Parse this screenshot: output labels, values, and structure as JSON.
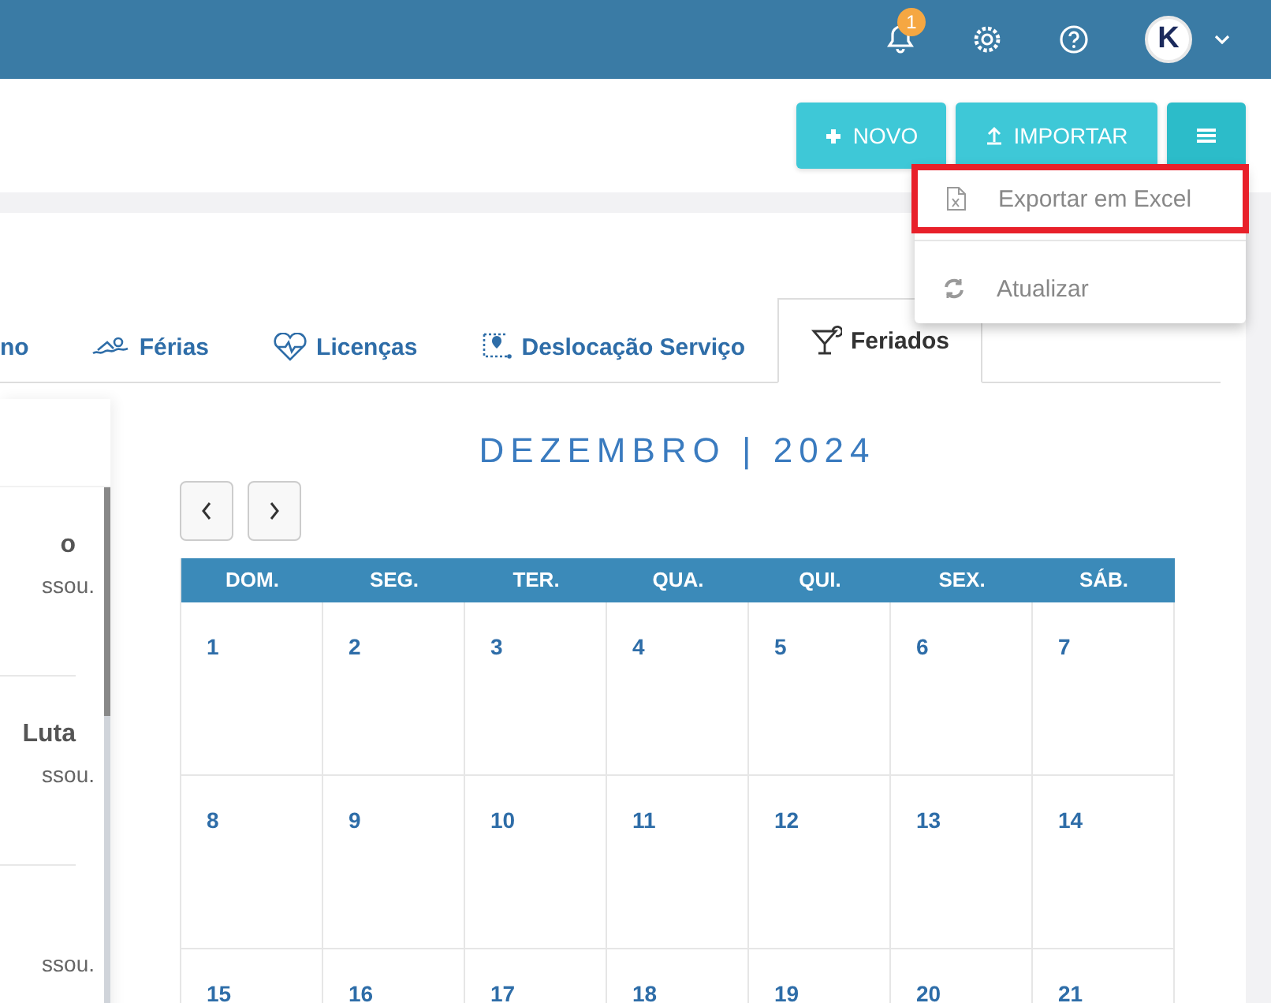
{
  "header": {
    "notification_count": "1",
    "avatar_letter": "K"
  },
  "toolbar": {
    "buttons": [
      {
        "kind": "new",
        "label": "NOVO"
      },
      {
        "kind": "import",
        "label": "IMPORTAR"
      },
      {
        "kind": "menu"
      }
    ]
  },
  "menu": {
    "items": [
      {
        "kind": "excel",
        "label": "Exportar em Excel",
        "highlighted": true
      },
      {
        "kind": "refresh",
        "label": "Atualizar",
        "highlighted": false
      }
    ]
  },
  "tabs": [
    {
      "kind": "partial",
      "label": "no",
      "selected": false
    },
    {
      "kind": "vacation",
      "label": "Férias",
      "selected": false
    },
    {
      "kind": "leave",
      "label": "Licenças",
      "selected": false
    },
    {
      "kind": "travel",
      "label": "Deslocação Serviço",
      "selected": false
    },
    {
      "kind": "holiday",
      "label": "Feriados",
      "selected": true
    }
  ],
  "list": {
    "items": [
      {
        "title": "o",
        "text": "ssou."
      },
      {
        "title": "Luta",
        "text": "ssou."
      },
      {
        "text": "ssou."
      }
    ]
  },
  "calendar": {
    "title": "DEZEMBRO | 2024",
    "weekdays": [
      "DOM.",
      "SEG.",
      "TER.",
      "QUA.",
      "QUI.",
      "SEX.",
      "SÁB."
    ],
    "weeks": [
      [
        "1",
        "2",
        "3",
        "4",
        "5",
        "6",
        "7"
      ],
      [
        "8",
        "9",
        "10",
        "11",
        "12",
        "13",
        "14"
      ],
      [
        "15",
        "16",
        "17",
        "18",
        "19",
        "20",
        "21"
      ]
    ]
  }
}
